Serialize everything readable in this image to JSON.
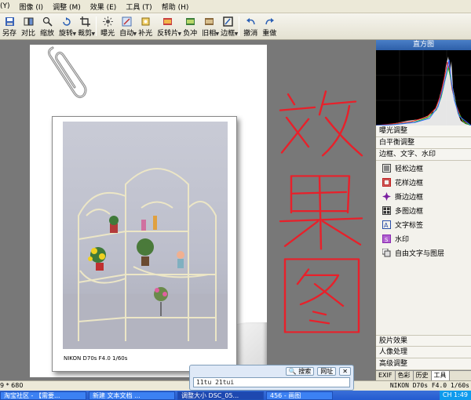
{
  "menubar": {
    "items": [
      "(Y)",
      "图像 (I)",
      "调整 (M)",
      "效果 (E)",
      "工具 (T)",
      "帮助 (H)"
    ]
  },
  "toolbar": {
    "buttons": [
      {
        "label": "另存",
        "icon": "save-as-icon",
        "dropdown": false
      },
      {
        "label": "对比",
        "icon": "compare-icon",
        "dropdown": false
      },
      {
        "label": "缩放",
        "icon": "zoom-icon",
        "dropdown": false
      },
      {
        "label": "旋转",
        "icon": "rotate-icon",
        "dropdown": true
      },
      {
        "label": "裁剪",
        "icon": "crop-icon",
        "dropdown": true
      },
      {
        "label": "曝光",
        "icon": "exposure-icon",
        "dropdown": false
      },
      {
        "label": "自动",
        "icon": "auto-icon",
        "dropdown": true
      },
      {
        "label": "补光",
        "icon": "fill-light-icon",
        "dropdown": false
      },
      {
        "label": "反转片",
        "icon": "reversal-film-icon",
        "dropdown": true
      },
      {
        "label": "负冲",
        "icon": "cross-process-icon",
        "dropdown": false
      },
      {
        "label": "旧相",
        "icon": "old-photo-icon",
        "dropdown": true
      },
      {
        "label": "边框",
        "icon": "frame-icon",
        "dropdown": true
      },
      {
        "label": "撤消",
        "icon": "undo-icon",
        "dropdown": false
      },
      {
        "label": "重做",
        "icon": "redo-icon",
        "dropdown": false
      }
    ]
  },
  "canvas": {
    "photo_caption": "NIKON D70s F4.0 1/60s",
    "annotation_text": "效果图",
    "annotation_color": "#e8202a"
  },
  "panel": {
    "title": "直方图",
    "sections": [
      "曝光调整",
      "白平衡调整",
      "边框、文字、水印"
    ],
    "items": [
      {
        "label": "轻松边框",
        "icon": "easy-frame-icon",
        "color": "#555555"
      },
      {
        "label": "花样边框",
        "icon": "pattern-frame-icon",
        "color": "#c02020"
      },
      {
        "label": "撕边边框",
        "icon": "torn-edge-icon",
        "color": "#7a1fa0"
      },
      {
        "label": "多图边框",
        "icon": "multi-frame-icon",
        "color": "#333333"
      },
      {
        "label": "文字标签",
        "icon": "text-label-icon",
        "color": "#2a4fa8"
      },
      {
        "label": "水印",
        "icon": "watermark-icon",
        "color": "#8a2ab0"
      },
      {
        "label": "自由文字与图层",
        "icon": "free-text-layer-icon",
        "color": "#444444"
      }
    ],
    "bottom_sections": [
      "胶片效果",
      "人像处理",
      "高级调整"
    ],
    "tabs": [
      "EXIF",
      "色彩",
      "历史",
      "工具"
    ],
    "active_tab": "工具"
  },
  "statusbar": {
    "left": "9 * 680",
    "right": "NIKON D70s F4.0 1/60s"
  },
  "popup": {
    "search_label": "搜索",
    "web_label": "网址",
    "input_value": "11tu 21tui"
  },
  "taskbar": {
    "items": [
      "淘宝社区 - 【需要...",
      "新建 文本文档 ...",
      "调整大小 DSC_05...",
      "456 - 画图"
    ],
    "tray": "CH  1:49"
  }
}
